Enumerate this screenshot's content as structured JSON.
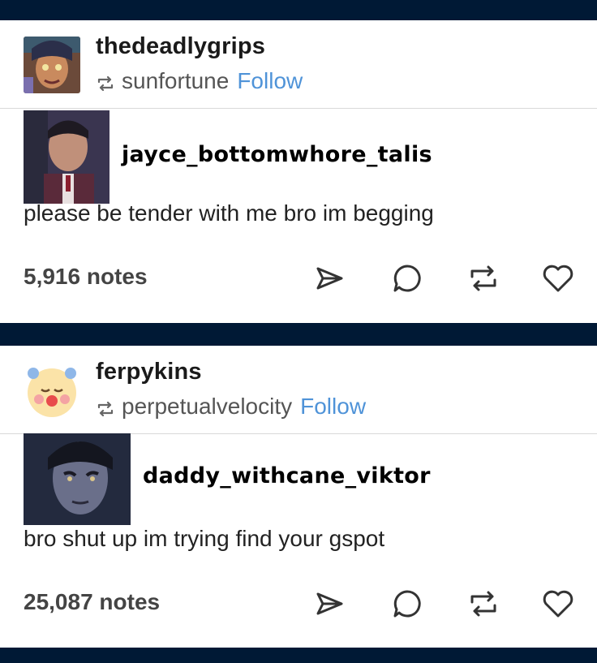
{
  "posts": [
    {
      "blog_name": "thedeadlygrips",
      "reblogged_from": "sunfortune",
      "follow_label": "Follow",
      "quoted_user": "jayce_bottomwhore_talis",
      "text": "please be tender with me bro im begging",
      "notes": "5,916 notes",
      "icons": [
        "share-icon",
        "comment-icon",
        "reblog-icon",
        "like-icon"
      ]
    },
    {
      "blog_name": "ferpykins",
      "reblogged_from": "perpetualvelocity",
      "follow_label": "Follow",
      "quoted_user": "daddy_withcane_viktor",
      "text": "bro shut up im trying find your gspot",
      "notes": "25,087 notes",
      "icons": [
        "share-icon",
        "comment-icon",
        "reblog-icon",
        "like-icon"
      ]
    }
  ],
  "colors": {
    "page_bg": "#001935",
    "follow": "#4f93d8",
    "notes": "#444444"
  }
}
